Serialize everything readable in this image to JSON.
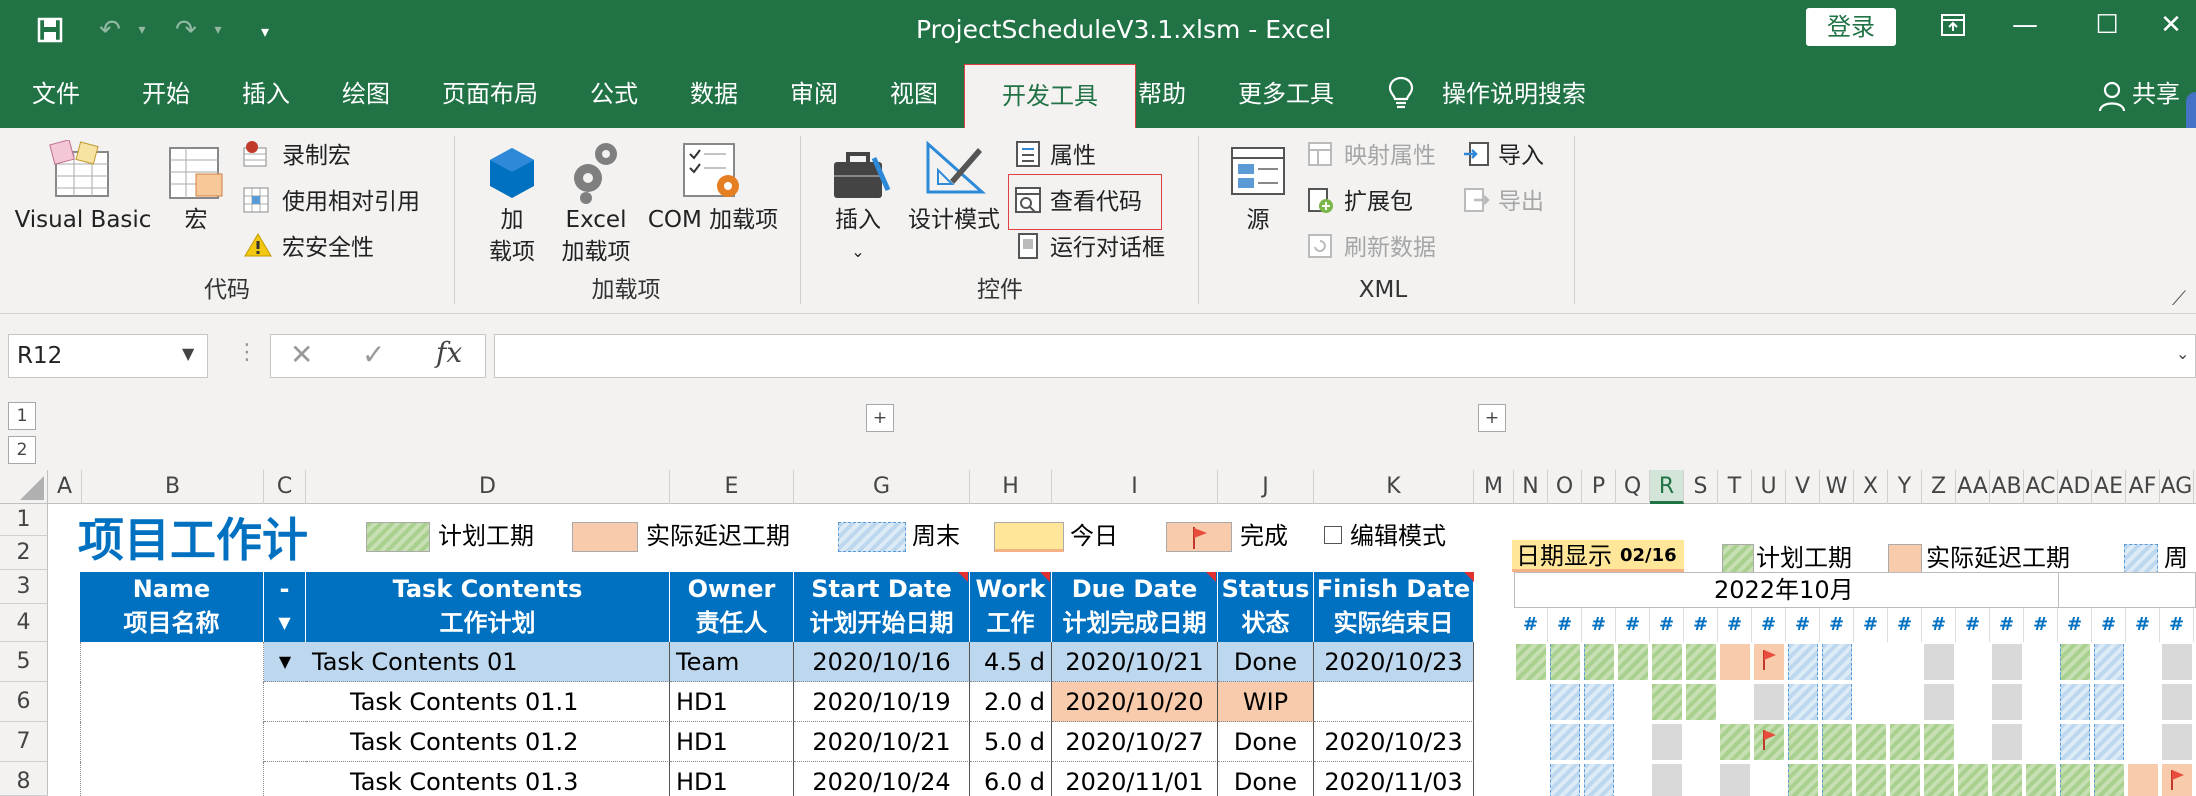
{
  "window": {
    "title": "ProjectScheduleV3.1.xlsm  -  Excel",
    "login": "登录"
  },
  "menu": {
    "items": [
      "文件",
      "开始",
      "插入",
      "绘图",
      "页面布局",
      "公式",
      "数据",
      "审阅",
      "视图",
      "开发工具",
      "帮助",
      "更多工具"
    ],
    "active": "开发工具",
    "tell_me": "操作说明搜索",
    "share": "共享"
  },
  "ribbon": {
    "code": {
      "group": "代码",
      "visual_basic": "Visual Basic",
      "macros": "宏",
      "record_macro": "录制宏",
      "relative_ref": "使用相对引用",
      "macro_security": "宏安全性"
    },
    "addins": {
      "group": "加载项",
      "addins_line1": "加",
      "addins_line2": "载项",
      "excel_addins_line1": "Excel",
      "excel_addins_line2": "加载项",
      "com_addins": "COM 加载项"
    },
    "controls": {
      "group": "控件",
      "insert": "插入",
      "design_mode": "设计模式",
      "properties": "属性",
      "view_code": "查看代码",
      "run_dialog": "运行对话框"
    },
    "xml": {
      "group": "XML",
      "source": "源",
      "map_properties": "映射属性",
      "expansion_packs": "扩展包",
      "refresh_data": "刷新数据",
      "import": "导入",
      "export": "导出"
    }
  },
  "formula_bar": {
    "name_box": "R12",
    "formula": ""
  },
  "outline_levels": [
    "1",
    "2"
  ],
  "columns": [
    "A",
    "B",
    "C",
    "D",
    "E",
    "G",
    "H",
    "I",
    "J",
    "K",
    "M",
    "N",
    "O",
    "P",
    "Q",
    "R",
    "S",
    "T",
    "U",
    "V",
    "W",
    "X",
    "Y",
    "Z",
    "AA",
    "AB",
    "AC",
    "AD",
    "AE",
    "AF",
    "AG"
  ],
  "rows": [
    "1",
    "2",
    "3",
    "4",
    "5",
    "6",
    "7",
    "8"
  ],
  "sheet": {
    "title": "项目工作计",
    "legend": {
      "planned": "计划工期",
      "delay": "实际延迟工期",
      "weekend": "周末",
      "today": "今日",
      "done": "完成",
      "edit_mode": "编辑模式"
    },
    "date_display_label": "日期显示",
    "date_display_value": "02/16",
    "gantt_legend_planned": "计划工期",
    "gantt_legend_delay": "实际延迟工期",
    "gantt_legend_weekend": "周",
    "month": "2022年10月",
    "headers": [
      {
        "en": "Name",
        "cn": "项目名称"
      },
      {
        "en": "-",
        "cn": ""
      },
      {
        "en": "Task Contents",
        "cn": "工作计划"
      },
      {
        "en": "Owner",
        "cn": "责任人"
      },
      {
        "en": "Start Date",
        "cn": "计划开始日期"
      },
      {
        "en": "Work",
        "cn": "工作"
      },
      {
        "en": "Due Date",
        "cn": "计划完成日期"
      },
      {
        "en": "Status",
        "cn": "状态"
      },
      {
        "en": "Finish Date",
        "cn": "实际结束日"
      }
    ],
    "tasks": [
      {
        "task": "Task Contents 01",
        "owner": "Team",
        "start": "2020/10/16",
        "work": "4.5 d",
        "due": "2020/10/21",
        "status": "Done",
        "finish": "2020/10/23",
        "level": 0
      },
      {
        "task": "Task Contents 01.1",
        "owner": "HD1",
        "start": "2020/10/19",
        "work": "2.0 d",
        "due": "2020/10/20",
        "status": "WIP",
        "finish": "",
        "level": 1
      },
      {
        "task": "Task Contents 01.2",
        "owner": "HD1",
        "start": "2020/10/21",
        "work": "5.0 d",
        "due": "2020/10/27",
        "status": "Done",
        "finish": "2020/10/23",
        "level": 1
      },
      {
        "task": "Task Contents 01.3",
        "owner": "HD1",
        "start": "2020/10/24",
        "work": "6.0 d",
        "due": "2020/11/01",
        "status": "Done",
        "finish": "2020/11/03",
        "level": 1
      }
    ]
  },
  "colors": {
    "excel_green": "#217346",
    "header_blue": "#0070c0",
    "title_blue": "#0070c0",
    "salmon": "#f8cbad",
    "row_blue": "#bdd7ee"
  }
}
